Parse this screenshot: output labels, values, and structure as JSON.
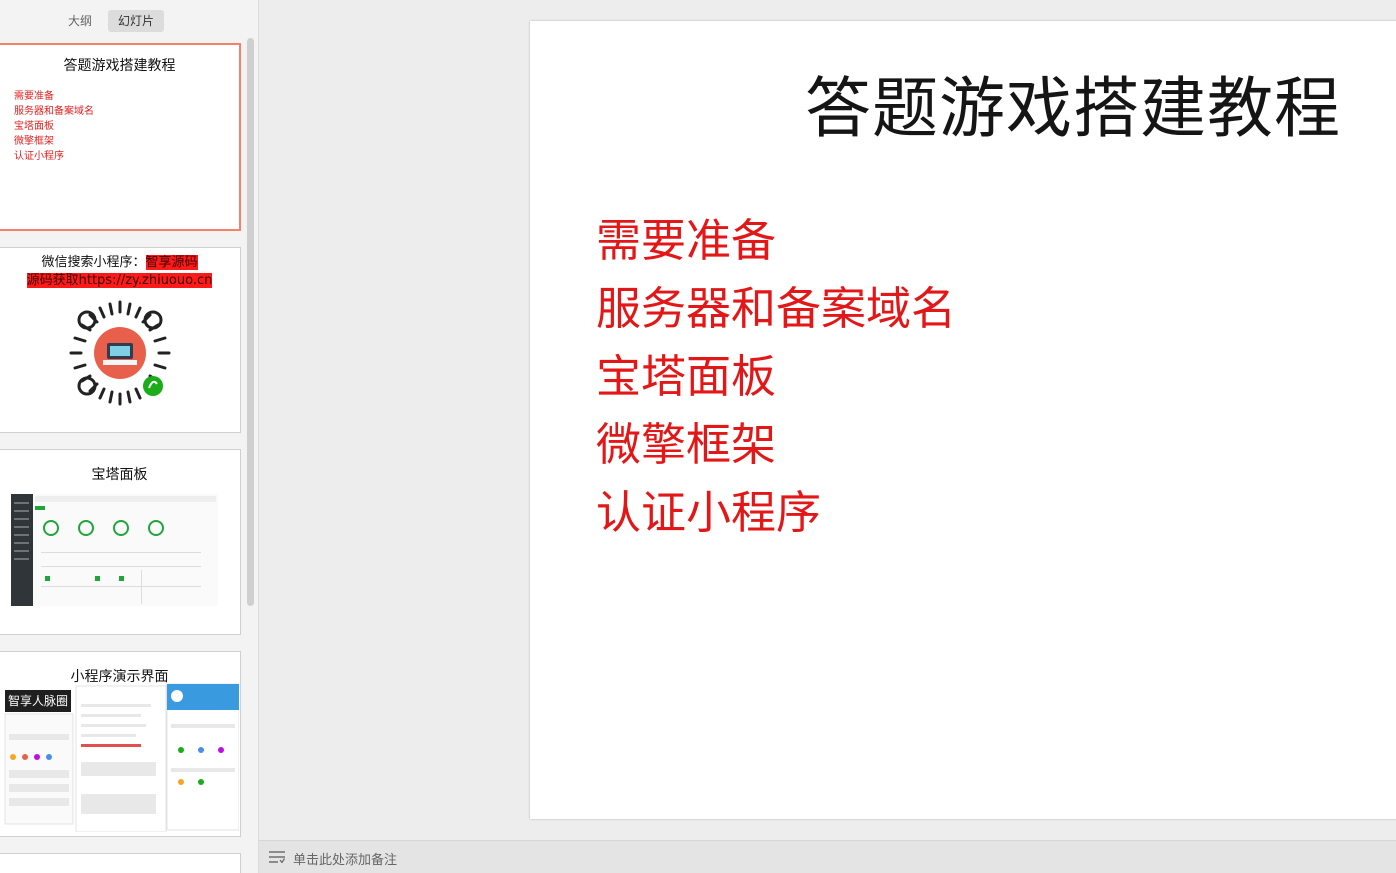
{
  "sidebar": {
    "tabs": [
      {
        "label": "大纲"
      },
      {
        "label": "幻灯片"
      }
    ],
    "slides": [
      {
        "title": "答题游戏搭建教程",
        "items": [
          "需要准备",
          "服务器和备案域名",
          "宝塔面板",
          "微擎框架",
          "认证小程序"
        ]
      },
      {
        "line1_prefix": "微信搜索小程序：",
        "line1_highlight": "智享源码",
        "line2_highlight": "源码获取https://zy.zhiuouo.cn"
      },
      {
        "title": "宝塔面板"
      },
      {
        "title": "小程序演示界面",
        "logo_text": "智享人脉圈"
      }
    ]
  },
  "slide": {
    "title": "答题游戏搭建教程",
    "items": [
      "需要准备",
      "服务器和备案域名",
      "宝塔面板",
      "微擎框架",
      "认证小程序"
    ]
  },
  "notes": {
    "placeholder": "单击此处添加备注"
  },
  "colors": {
    "accent_red": "#e31717",
    "selected_border": "#f4826b"
  }
}
